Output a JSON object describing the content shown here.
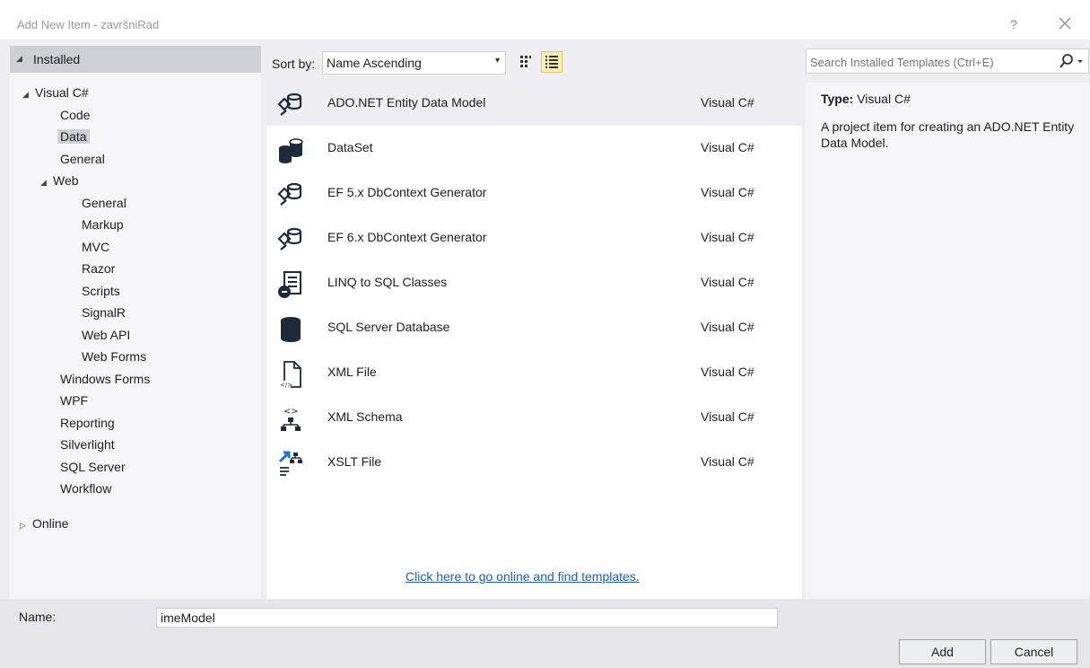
{
  "window": {
    "title": "Add New Item - završniRad",
    "help_label": "?",
    "close_label": "✕"
  },
  "left": {
    "installed_label": "Installed",
    "tree": [
      {
        "label": "Visual C#",
        "expander": "◢"
      },
      {
        "label": "Code"
      },
      {
        "label": "Data",
        "selected": true
      },
      {
        "label": "General"
      },
      {
        "label": "Web",
        "expander": "◢"
      },
      {
        "label": "General"
      },
      {
        "label": "Markup"
      },
      {
        "label": "MVC"
      },
      {
        "label": "Razor"
      },
      {
        "label": "Scripts"
      },
      {
        "label": "SignalR"
      },
      {
        "label": "Web API"
      },
      {
        "label": "Web Forms"
      },
      {
        "label": "Windows Forms"
      },
      {
        "label": "WPF"
      },
      {
        "label": "Reporting"
      },
      {
        "label": "Silverlight"
      },
      {
        "label": "SQL Server"
      },
      {
        "label": "Workflow"
      }
    ],
    "online_label": "Online",
    "expanded_glyph": "◢",
    "collapsed_glyph": "▷"
  },
  "toolbar": {
    "sort_label": "Sort by:",
    "sort_value": "Name Ascending",
    "sort_arrow": "▾",
    "grid_view_icon": "small-icons-view-icon",
    "list_view_icon": "details-view-icon"
  },
  "templates": [
    {
      "name": "ADO.NET Entity Data Model",
      "lang": "Visual C#",
      "icon": "entity-model-icon",
      "selected": true
    },
    {
      "name": "DataSet",
      "lang": "Visual C#",
      "icon": "dataset-icon"
    },
    {
      "name": "EF 5.x DbContext Generator",
      "lang": "Visual C#",
      "icon": "entity-model-icon"
    },
    {
      "name": "EF 6.x DbContext Generator",
      "lang": "Visual C#",
      "icon": "entity-model-icon"
    },
    {
      "name": "LINQ to SQL Classes",
      "lang": "Visual C#",
      "icon": "linq-classes-icon"
    },
    {
      "name": "SQL Server Database",
      "lang": "Visual C#",
      "icon": "database-icon"
    },
    {
      "name": "XML File",
      "lang": "Visual C#",
      "icon": "xml-file-icon"
    },
    {
      "name": "XML Schema",
      "lang": "Visual C#",
      "icon": "xml-schema-icon"
    },
    {
      "name": "XSLT File",
      "lang": "Visual C#",
      "icon": "xslt-file-icon"
    }
  ],
  "online_link": "Click here to go online and find templates.",
  "search": {
    "placeholder": "Search Installed Templates (Ctrl+E)",
    "dropdown_glyph": "▾"
  },
  "details": {
    "type_label": "Type:",
    "type_value": "Visual C#",
    "description": "A project item for creating an ADO.NET Entity Data Model."
  },
  "bottom": {
    "name_label": "Name:",
    "name_value": "imeModel",
    "add_label": "Add",
    "cancel_label": "Cancel"
  },
  "colors": {
    "selected_bg": "#cfd0d6",
    "link": "#1e5fb4",
    "accent_icon": "#1e2a3a"
  }
}
